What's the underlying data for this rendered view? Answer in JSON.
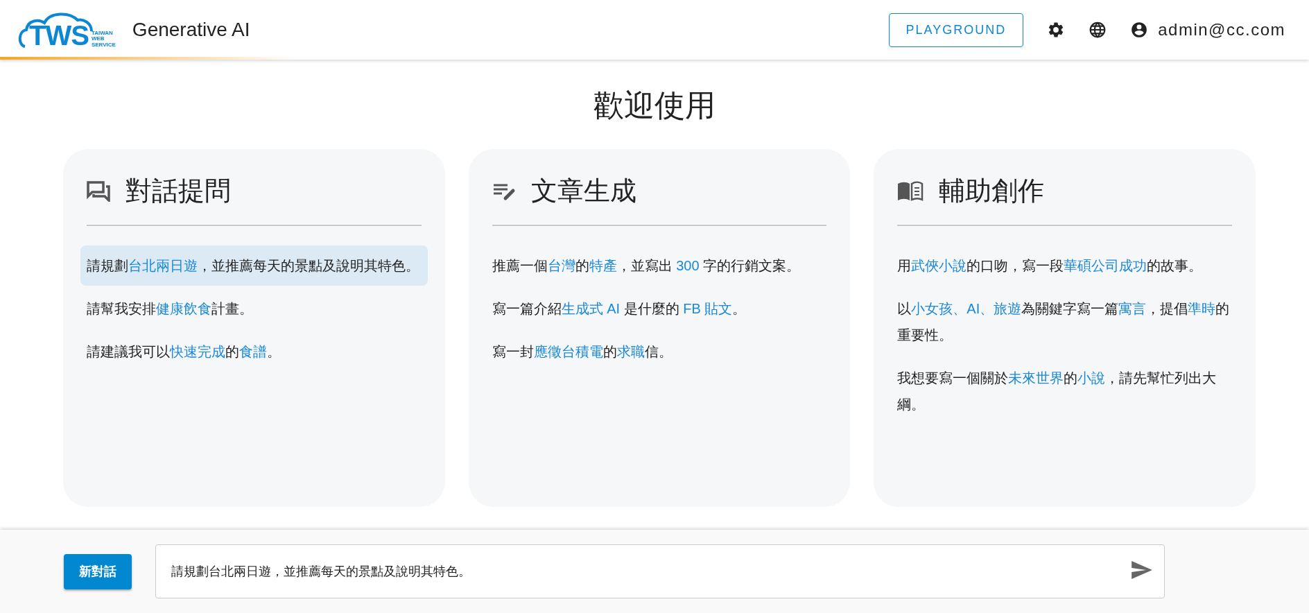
{
  "header": {
    "logo": {
      "letters": "TWS",
      "tagline": [
        "TAIWAN",
        "WEB",
        "SERVICE"
      ]
    },
    "title": "Generative AI",
    "playground_button": "PLAYGROUND",
    "user_email": "admin@cc.com"
  },
  "heading": "歡迎使用",
  "cards": [
    {
      "kind": "chat",
      "title": "對話提問",
      "prompts": [
        {
          "selected": true,
          "segments": [
            {
              "text": "請規劃",
              "highlight": false
            },
            {
              "text": "台北兩日遊",
              "highlight": true
            },
            {
              "text": "，並推薦每天的景點及說明其特色。",
              "highlight": false
            }
          ]
        },
        {
          "selected": false,
          "segments": [
            {
              "text": "請幫我安排",
              "highlight": false
            },
            {
              "text": "健康飲食",
              "highlight": true
            },
            {
              "text": "計畫。",
              "highlight": false
            }
          ]
        },
        {
          "selected": false,
          "segments": [
            {
              "text": "請建議我可以",
              "highlight": false
            },
            {
              "text": "快速完成",
              "highlight": true
            },
            {
              "text": "的",
              "highlight": false
            },
            {
              "text": "食譜",
              "highlight": true
            },
            {
              "text": "。",
              "highlight": false
            }
          ]
        }
      ]
    },
    {
      "kind": "write",
      "title": "文章生成",
      "prompts": [
        {
          "selected": false,
          "segments": [
            {
              "text": "推薦一個",
              "highlight": false
            },
            {
              "text": "台灣",
              "highlight": true
            },
            {
              "text": "的",
              "highlight": false
            },
            {
              "text": "特產",
              "highlight": true
            },
            {
              "text": "，並寫出 ",
              "highlight": false
            },
            {
              "text": "300",
              "highlight": true
            },
            {
              "text": " 字的行銷文案。",
              "highlight": false
            }
          ]
        },
        {
          "selected": false,
          "segments": [
            {
              "text": "寫一篇介紹",
              "highlight": false
            },
            {
              "text": "生成式 AI",
              "highlight": true
            },
            {
              "text": " 是什麼的 ",
              "highlight": false
            },
            {
              "text": "FB 貼文",
              "highlight": true
            },
            {
              "text": "。",
              "highlight": false
            }
          ]
        },
        {
          "selected": false,
          "segments": [
            {
              "text": "寫一封",
              "highlight": false
            },
            {
              "text": "應徵台積電",
              "highlight": true
            },
            {
              "text": "的",
              "highlight": false
            },
            {
              "text": "求職",
              "highlight": true
            },
            {
              "text": "信。",
              "highlight": false
            }
          ]
        }
      ]
    },
    {
      "kind": "create",
      "title": "輔助創作",
      "prompts": [
        {
          "selected": false,
          "segments": [
            {
              "text": "用",
              "highlight": false
            },
            {
              "text": "武俠小說",
              "highlight": true
            },
            {
              "text": "的口吻，寫一段",
              "highlight": false
            },
            {
              "text": "華碩公司成功",
              "highlight": true
            },
            {
              "text": "的故事。",
              "highlight": false
            }
          ]
        },
        {
          "selected": false,
          "segments": [
            {
              "text": "以",
              "highlight": false
            },
            {
              "text": "小女孩、AI、旅遊",
              "highlight": true
            },
            {
              "text": "為關鍵字寫一篇",
              "highlight": false
            },
            {
              "text": "寓言",
              "highlight": true
            },
            {
              "text": "，提倡",
              "highlight": false
            },
            {
              "text": "準時",
              "highlight": true
            },
            {
              "text": "的重要性。",
              "highlight": false
            }
          ]
        },
        {
          "selected": false,
          "segments": [
            {
              "text": "我想要寫一個關於",
              "highlight": false
            },
            {
              "text": "未來世界",
              "highlight": true
            },
            {
              "text": "的",
              "highlight": false
            },
            {
              "text": "小說",
              "highlight": true
            },
            {
              "text": "，請先幫忙列出大綱。",
              "highlight": false
            }
          ]
        }
      ]
    }
  ],
  "footer": {
    "new_chat_button": "新對話",
    "message": "請規劃台北兩日遊，並推薦每天的景點及說明其特色。"
  }
}
